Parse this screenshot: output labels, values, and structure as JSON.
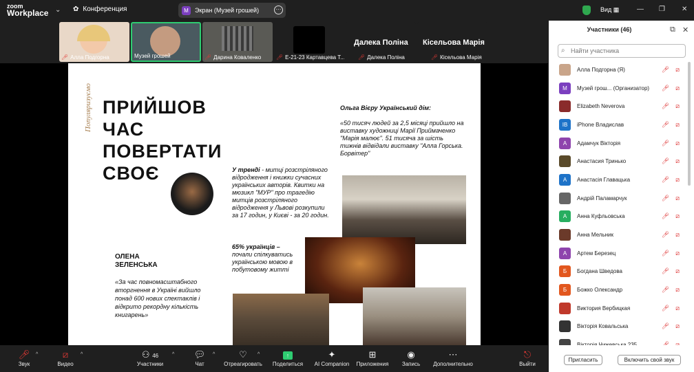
{
  "app": {
    "logo_small": "zoom",
    "logo_big": "Workplace",
    "meeting": "Конференция",
    "share_title": "Экран (Музей грошей)",
    "share_badge": "М",
    "view": "Вид"
  },
  "strip": {
    "tiles": [
      "Алла Подгорна",
      "Музей грошей",
      "Дарина Коваленко",
      "Е-21-23 Картавцева Т..."
    ],
    "big_names": [
      "Далека Поліна",
      "Кісельова Марія"
    ],
    "name_labels": [
      "Далека Поліна",
      "Кісельова Марія"
    ]
  },
  "slide": {
    "vertical": "Популяризуємо",
    "heading": [
      "ПРИЙШОВ",
      "ЧАС",
      "ПОВЕРТАТИ",
      "СВОЄ"
    ],
    "olga_title": "Ольга Вієру Український дім:",
    "olga_quote": "«50 тисяч людей за 2,5 місяці прийшло на виставку художниці Марії Приймаченко \"Марія малює\". 51 тисяча за шість тижнів відвідали виставку \"Алла Горська. Борвітер\"",
    "trend_bold": "У тренді",
    "trend_text": " - митці розстріляного відродження і книжки сучасних українських авторів. Квитки на мюзикл \"МУР\" про трагедію митців розстріляного відродження у Львові розкупили за 17 годин, у Києві - за 20 годин.",
    "pct_bold": "65% українців –",
    "pct_text": "почали спілкуватись українською мовою в побутовому житті",
    "olena_name": [
      "ОЛЕНА",
      "ЗЕЛЕНСЬКА"
    ],
    "olena_quote": "«За час повномасштабного вторгнення в Україні вийшло понад 600 нових спектаклів і відкрито рекордну кількість книгарень»"
  },
  "panel": {
    "title": "Участники (46)",
    "search_placeholder": "Найти участника",
    "participants": [
      {
        "name": "Алла Подгорна (Я)",
        "initial": "",
        "color": "#c9a58a"
      },
      {
        "name": "Музей грош...  (Организатор)",
        "initial": "М",
        "color": "#7b3fbf"
      },
      {
        "name": "Elizabeth Neverova",
        "initial": "",
        "color": "#8a2b2b"
      },
      {
        "name": "iPhone Владислав",
        "initial": "IB",
        "color": "#1e73c8"
      },
      {
        "name": "Адамчук Вікторія",
        "initial": "А",
        "color": "#8e44ad"
      },
      {
        "name": "Анастасия Тринько",
        "initial": "",
        "color": "#5a4a2a"
      },
      {
        "name": "Анастасія Главацька",
        "initial": "А",
        "color": "#1e73c8"
      },
      {
        "name": "Андрій Паламарчук",
        "initial": "",
        "color": "#666"
      },
      {
        "name": "Анна Куфльовська",
        "initial": "А",
        "color": "#27ae60"
      },
      {
        "name": "Анна Мельник",
        "initial": "",
        "color": "#6b3a2a"
      },
      {
        "name": "Артем Березец",
        "initial": "А",
        "color": "#8e44ad"
      },
      {
        "name": "Богдана Шведова",
        "initial": "Б",
        "color": "#e2571e"
      },
      {
        "name": "Божко Олександр",
        "initial": "Б",
        "color": "#e2571e"
      },
      {
        "name": "Виктория Вербицкая",
        "initial": "",
        "color": "#c0392b"
      },
      {
        "name": "Вікторія Ковальська",
        "initial": "",
        "color": "#333"
      },
      {
        "name": "Вікторія Чижевська 235",
        "initial": "",
        "color": "#444"
      }
    ],
    "invite": "Пригласить",
    "unmute_self": "Включить свой звук"
  },
  "toolbar": {
    "audio": "Звук",
    "video": "Видео",
    "participants": "Участники",
    "participants_count": "46",
    "chat": "Чат",
    "react": "Отреагировать",
    "share": "Поделиться",
    "ai": "AI Companion",
    "apps": "Приложения",
    "record": "Запись",
    "more": "Дополнительно",
    "leave": "Выйти"
  }
}
